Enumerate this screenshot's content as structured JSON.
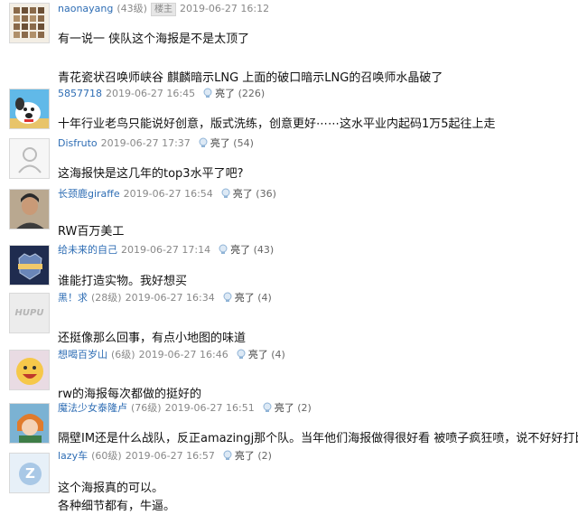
{
  "light_label": "亮了",
  "replies": [
    {
      "user": "naonayang",
      "level": "(43级)",
      "badge": "楼主",
      "time": "2019-06-27 16:12",
      "lines": [
        "有一说一 侠队这个海报是不是太顶了",
        "",
        "青花瓷状召唤师峡谷 麒麟暗示LNG 上面的破口暗示LNG的召唤师水晶破了"
      ],
      "avatar_icon": "mosaic-avatar"
    },
    {
      "user": "5857718",
      "time": "2019-06-27 16:45",
      "count": "(226)",
      "lines": [
        "十年行业老鸟只能说好创意，版式洗练，创意更好⋯⋯这水平业内起码1万5起往上走"
      ],
      "avatar_icon": "cartoon-dog-avatar"
    },
    {
      "user": "Disfruto",
      "time": "2019-06-27 17:37",
      "count": "(54)",
      "lines": [
        "这海报快是这几年的top3水平了吧?"
      ],
      "avatar_icon": "default-user-avatar"
    },
    {
      "user": "长颈鹿giraffe",
      "time": "2019-06-27 16:54",
      "count": "(36)",
      "lines": [
        "RW百万美工"
      ],
      "avatar_icon": "person-photo-avatar"
    },
    {
      "user": "给未来的自己",
      "time": "2019-06-27 17:14",
      "count": "(43)",
      "lines": [
        "谁能打造实物。我好想买"
      ],
      "avatar_icon": "grizzlies-logo-avatar"
    },
    {
      "user": "黑！求",
      "level": "(28级)",
      "time": "2019-06-27 16:34",
      "count": "(4)",
      "lines": [
        "还挺像那么回事，有点小地图的味道"
      ],
      "avatar_icon": "hupu-logo-avatar",
      "avatar_text": "HUPU"
    },
    {
      "user": "想喝百岁山",
      "level": "(6级)",
      "time": "2019-06-27 16:46",
      "count": "(4)",
      "lines": [
        "rw的海报每次都做的挺好的"
      ],
      "avatar_icon": "smiley-face-avatar"
    },
    {
      "user": "魔法少女泰隆卢",
      "level": "(76级)",
      "time": "2019-06-27 16:51",
      "count": "(2)",
      "lines": [
        "隔壁IM还是什么战队，反正amazingj那个队。当年他们海报做得很好看 被喷子疯狂喷，说不好好打比"
      ],
      "avatar_icon": "anime-character-avatar"
    },
    {
      "user": "lazy车",
      "level": "(60级)",
      "time": "2019-06-27 16:57",
      "count": "(2)",
      "lines": [
        "这个海报真的可以。",
        "各种细节都有，牛逼。"
      ],
      "avatar_icon": "z-logo-avatar",
      "avatar_text": "Z"
    }
  ]
}
